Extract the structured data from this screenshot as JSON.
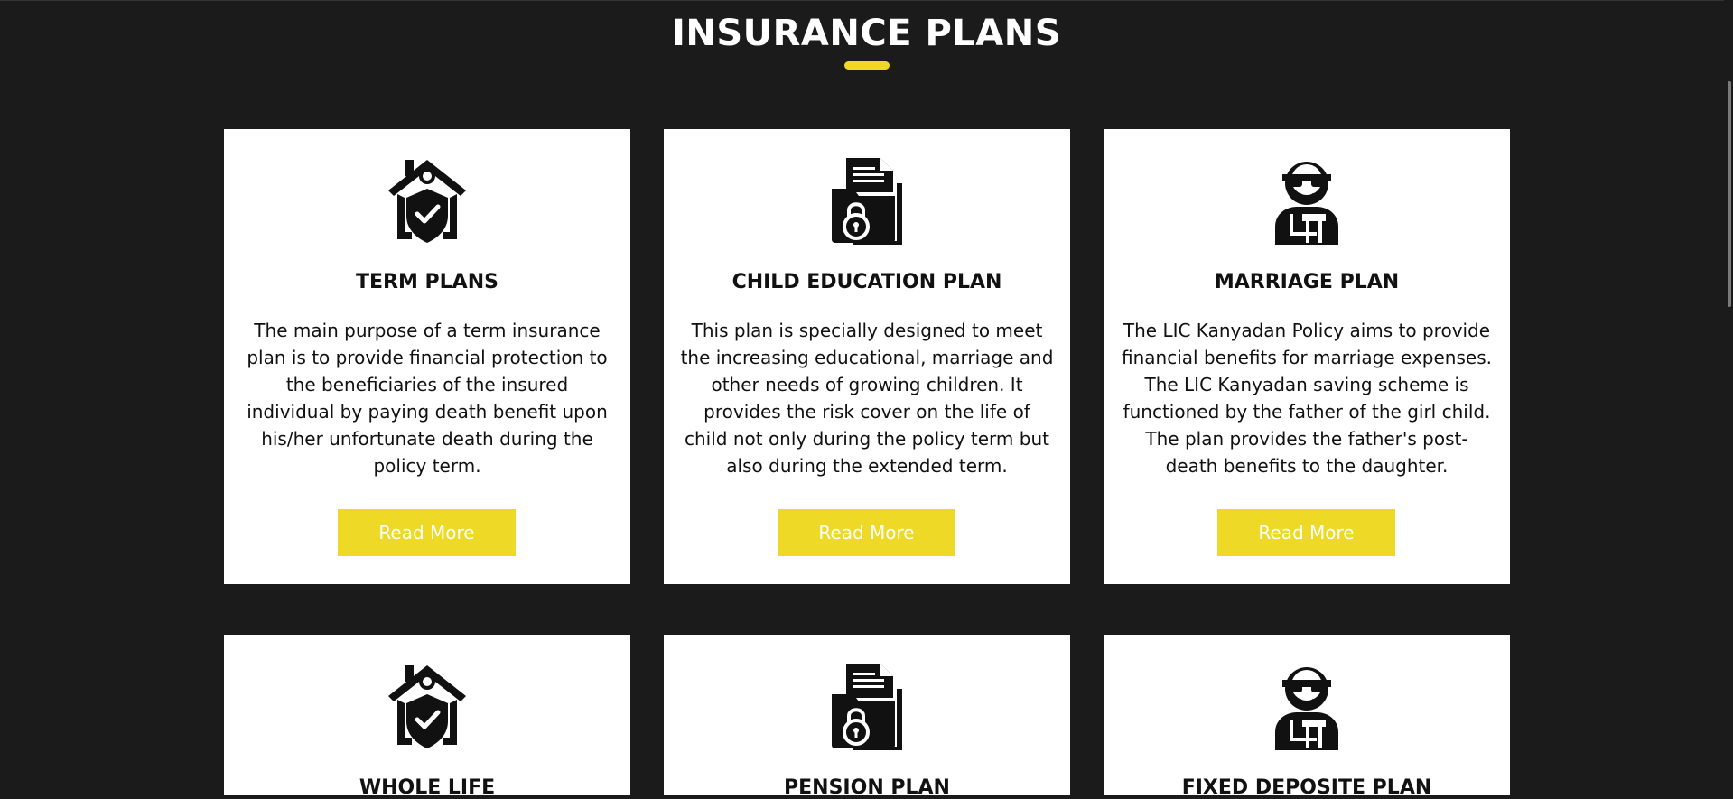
{
  "section": {
    "title": "INSURANCE PLANS",
    "accent_color": "#eeda26",
    "background_color": "#1b1b1b"
  },
  "plans": [
    {
      "title": "TERM PLANS",
      "icon": "house-shield-icon",
      "description": "The main purpose of a term insurance plan is to provide financial protection to the beneficiaries of the insured individual by paying death benefit upon his/her unfortunate death during the policy term.",
      "button_label": "Read More"
    },
    {
      "title": "CHILD EDUCATION PLAN",
      "icon": "folder-lock-icon",
      "description": "This plan is specially designed to meet the increasing educational, marriage and other needs of growing children. It provides the risk cover on the life of child not only during the policy term but also during the extended term.",
      "button_label": "Read More"
    },
    {
      "title": "MARRIAGE PLAN",
      "icon": "secret-agent-icon",
      "description": "The LIC Kanyadan Policy aims to provide financial benefits for marriage expenses. The LIC Kanyadan saving scheme is functioned by the father of the girl child. The plan provides the father's post-death benefits to the daughter.",
      "button_label": "Read More"
    },
    {
      "title": "WHOLE LIFE",
      "icon": "house-shield-icon"
    },
    {
      "title": "PENSION PLAN",
      "icon": "folder-lock-icon"
    },
    {
      "title": "FIXED DEPOSITE PLAN",
      "icon": "secret-agent-icon"
    }
  ]
}
